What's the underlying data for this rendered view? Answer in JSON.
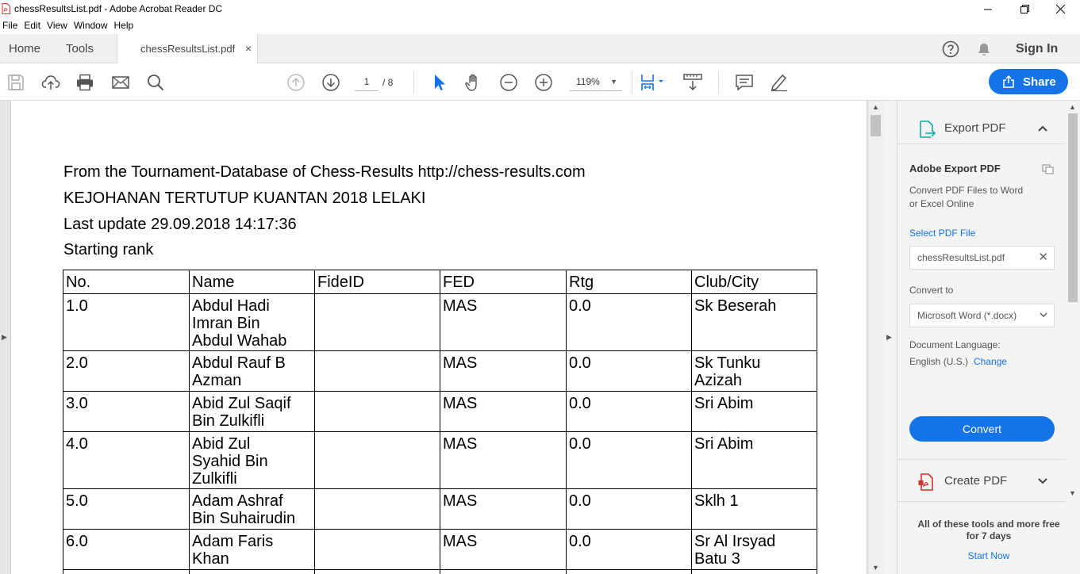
{
  "window": {
    "title": "chessResultsList.pdf - Adobe Acrobat Reader DC",
    "controls": [
      "minimize",
      "maximize",
      "close"
    ]
  },
  "menu": [
    "File",
    "Edit",
    "View",
    "Window",
    "Help"
  ],
  "tabs": {
    "home": "Home",
    "tools": "Tools",
    "document": "chessResultsList.pdf",
    "close_glyph": "×",
    "sign_in": "Sign In"
  },
  "toolbar": {
    "current_page": "1",
    "total_pages": "/ 8",
    "zoom": "119%",
    "zoom_caret": "▼",
    "share_label": "Share"
  },
  "document": {
    "heading_lines": [
      "From the Tournament-Database of Chess-Results http://chess-results.com",
      "KEJOHANAN TERTUTUP KUANTAN 2018 LELAKI",
      "Last update 29.09.2018 14:17:36",
      "Starting rank"
    ],
    "columns": [
      "No.",
      "Name",
      "FideID",
      "FED",
      "Rtg",
      "Club/City"
    ],
    "rows": [
      {
        "no": "1.0",
        "name_lines": [
          "Abdul Hadi",
          "Imran Bin",
          "Abdul Wahab"
        ],
        "fideid": "",
        "fed": "MAS",
        "rtg": "0.0",
        "club_lines": [
          "Sk Beserah"
        ]
      },
      {
        "no": "2.0",
        "name_lines": [
          "Abdul Rauf B",
          "Azman"
        ],
        "fideid": "",
        "fed": "MAS",
        "rtg": "0.0",
        "club_lines": [
          "Sk Tunku",
          "Azizah"
        ]
      },
      {
        "no": "3.0",
        "name_lines": [
          "Abid Zul Saqif",
          "Bin Zulkifli"
        ],
        "fideid": "",
        "fed": "MAS",
        "rtg": "0.0",
        "club_lines": [
          "Sri Abim"
        ]
      },
      {
        "no": "4.0",
        "name_lines": [
          "Abid Zul",
          "Syahid Bin",
          "Zulkifli"
        ],
        "fideid": "",
        "fed": "MAS",
        "rtg": "0.0",
        "club_lines": [
          "Sri Abim"
        ]
      },
      {
        "no": "5.0",
        "name_lines": [
          "Adam Ashraf",
          "Bin Suhairudin"
        ],
        "fideid": "",
        "fed": "MAS",
        "rtg": "0.0",
        "club_lines": [
          "Sklh 1"
        ]
      },
      {
        "no": "6.0",
        "name_lines": [
          "Adam Faris",
          "Khan"
        ],
        "fideid": "",
        "fed": "MAS",
        "rtg": "0.0",
        "club_lines": [
          "Sr Al Irsyad",
          "Batu 3"
        ]
      },
      {
        "no": "",
        "name_lines": [
          ""
        ],
        "fideid": "",
        "fed": "",
        "rtg": "",
        "club_lines": [
          ""
        ]
      }
    ]
  },
  "right_panel": {
    "export_header": "Export PDF",
    "export_title": "Adobe Export PDF",
    "export_desc_lines": [
      "Convert PDF Files to Word",
      "or Excel Online"
    ],
    "select_file_label": "Select PDF File",
    "selected_file": "chessResultsList.pdf",
    "convert_to_label": "Convert to",
    "convert_to_value": "Microsoft Word (*.docx)",
    "doc_language_label": "Document Language:",
    "doc_language_value": "English (U.S.)",
    "change_link": "Change",
    "convert_button": "Convert",
    "create_header": "Create PDF",
    "promo_text": "All of these tools and more free for 7 days",
    "start_now": "Start Now"
  },
  "colors": {
    "accent": "#1473e6",
    "pdf_red": "#d8302f"
  },
  "icons": [
    "app-pdf-icon",
    "minimize-icon",
    "maximize-icon",
    "close-icon",
    "help-icon",
    "bell-icon",
    "save-icon",
    "upload-icon",
    "print-icon",
    "email-icon",
    "search-icon",
    "prev-page-icon",
    "next-page-icon",
    "select-cursor-icon",
    "hand-tool-icon",
    "zoom-out-icon",
    "zoom-in-icon",
    "fit-page-icon",
    "scroll-mode-icon",
    "comment-icon",
    "highlight-icon",
    "share-icon",
    "export-pdf-icon",
    "create-pdf-icon",
    "chevron-up-icon",
    "chevron-down-icon"
  ]
}
